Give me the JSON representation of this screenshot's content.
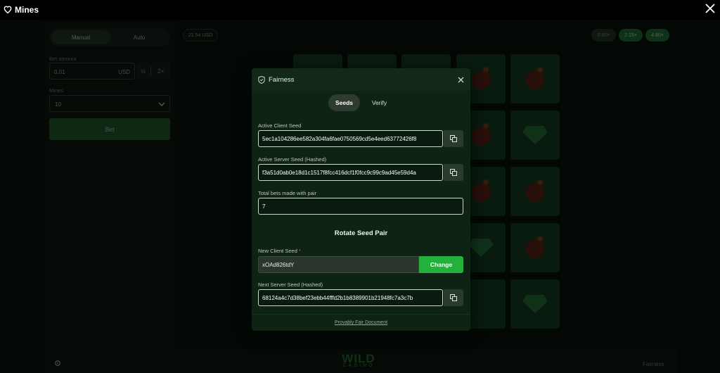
{
  "window": {
    "title": "Mines"
  },
  "side": {
    "modes": [
      "Manual",
      "Auto"
    ],
    "bet_amount_label": "Bet amount",
    "bet_amount_value": "0.01",
    "currency": "USD",
    "half_label": "½",
    "double_label": "2×",
    "mines_label": "Mines",
    "mines_value": "10",
    "bet_button": "Bet"
  },
  "game": {
    "balance": "21.54 USD",
    "multipliers": [
      "0.00×",
      "2.15×",
      "4.80×"
    ],
    "multiplier_colors": [
      "#1c2a20",
      "#1d5a2a",
      "#1d5a2a"
    ]
  },
  "footer": {
    "fairness_label": "Fairness",
    "logo_text": "WILD",
    "logo_sub": "CASINO"
  },
  "modal": {
    "title": "Fairness",
    "tabs": [
      "Seeds",
      "Verify"
    ],
    "active_client_label": "Active Client Seed",
    "active_client_value": "5ec1a104286ee582a304fa6fae0750569cd5e4eed63772426f8",
    "active_server_label": "Active Server Seed (Hashed)",
    "active_server_value": "f3a51d0ab0e18d1c1517f8fcc416dcf1f0fcc9c99c9ad45e59d4a",
    "total_bets_label": "Total bets made with pair",
    "total_bets_value": "7",
    "rotate_title": "Rotate Seed Pair",
    "new_client_label": "New Client Seed",
    "new_client_required": "*",
    "new_client_value": "xOAd826tdY",
    "change_button": "Change",
    "next_server_label": "Next Server Seed (Hashed)",
    "next_server_value": "68124a4c7d38bef23ebb44fffd2b1b8389901b21948fc7a3c7b",
    "doc_link": "Provably Fair Document"
  },
  "colors": {
    "accent": "#22b13a",
    "modal_bg": "#0f2314"
  }
}
